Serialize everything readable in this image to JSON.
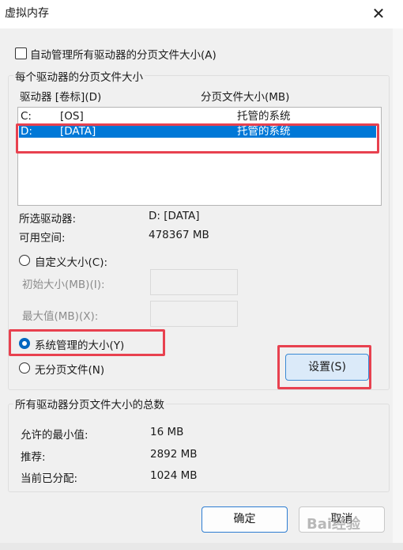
{
  "window": {
    "title": "虚拟内存",
    "close_glyph": "✕"
  },
  "auto_manage": {
    "label": "自动管理所有驱动器的分页文件大小(A)",
    "checked": false
  },
  "per_drive": {
    "group_title": "每个驱动器的分页文件大小",
    "col_drive": "驱动器 [卷标](D)",
    "col_size": "分页文件大小(MB)",
    "rows": [
      {
        "drive": "C:",
        "label": "[OS]",
        "size": "托管的系统",
        "selected": false
      },
      {
        "drive": "D:",
        "label": "[DATA]",
        "size": "托管的系统",
        "selected": true
      }
    ],
    "selected_drive_label": "所选驱动器:",
    "selected_drive_value": "D:  [DATA]",
    "free_space_label": "可用空间:",
    "free_space_value": "478367 MB",
    "custom_size_label": "自定义大小(C):",
    "initial_size_label": "初始大小(MB)(I):",
    "max_size_label": "最大值(MB)(X):",
    "system_managed_label": "系统管理的大小(Y)",
    "no_paging_label": "无分页文件(N)",
    "set_button": "设置(S)",
    "selected_option": "system_managed"
  },
  "totals": {
    "group_title": "所有驱动器分页文件大小的总数",
    "min_label": "允许的最小值:",
    "min_value": "16 MB",
    "recommended_label": "推荐:",
    "recommended_value": "2892 MB",
    "current_label": "当前已分配:",
    "current_value": "1024 MB"
  },
  "footer": {
    "ok_button": "确定",
    "cancel_button": "取消"
  },
  "watermark": "Bai经验",
  "colors": {
    "selection": "#0078d7",
    "highlight_box": "#e8414f",
    "radio_on": "#0067c0"
  }
}
